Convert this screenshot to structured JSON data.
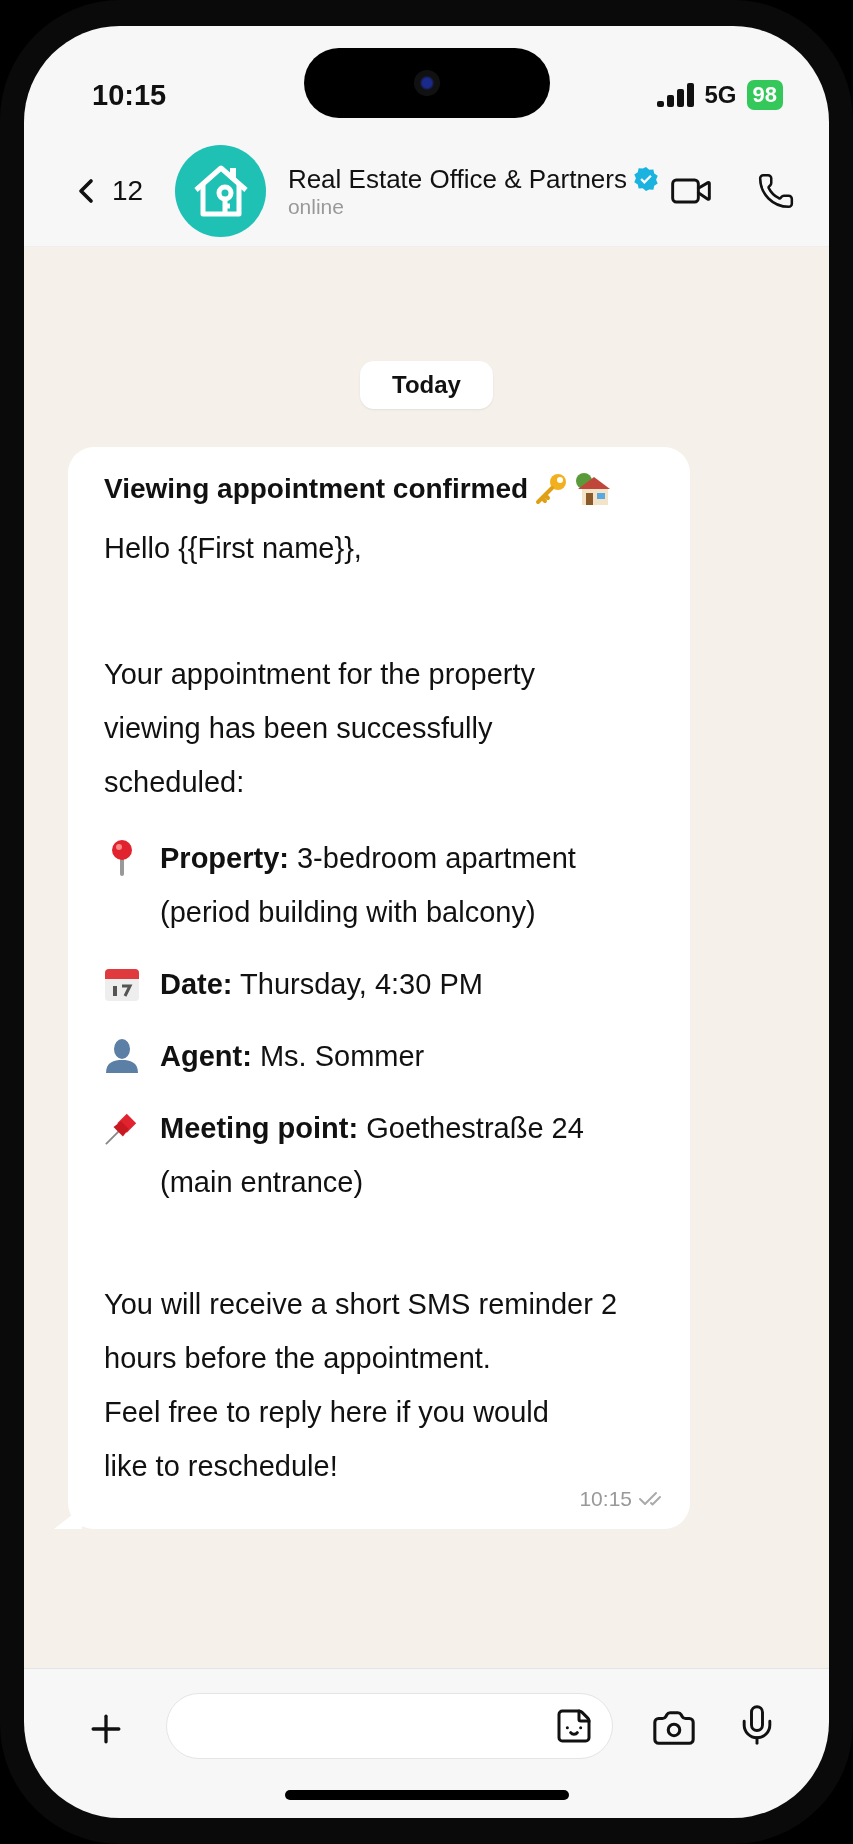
{
  "status_bar": {
    "time": "10:15",
    "network": "5G",
    "battery": "98"
  },
  "header": {
    "back_count": "12",
    "name": "Real Estate Office & Partners",
    "verified": true,
    "status": "online"
  },
  "date_chip": "Today",
  "message": {
    "title": "Viewing appointment confirmed",
    "greeting": "Hello {{First name}},",
    "intro": "Your appointment for the property viewing has been successfully scheduled:",
    "details": [
      {
        "kind": "pin",
        "label": "Property:",
        "value": "3-bedroom apartment (period building with balcony)"
      },
      {
        "kind": "calendar",
        "label": "Date:",
        "value": "Thursday, 4:30 PM"
      },
      {
        "kind": "person",
        "label": "Agent:",
        "value": "Ms. Sommer"
      },
      {
        "kind": "pushpin",
        "label": "Meeting point:",
        "value": "Goethestraße 24 (main entrance)"
      }
    ],
    "closing": [
      "You will receive a short SMS reminder 2 hours before the appointment.",
      "Feel free to reply here if you would like to reschedule!"
    ],
    "time": "10:15",
    "read": true
  }
}
